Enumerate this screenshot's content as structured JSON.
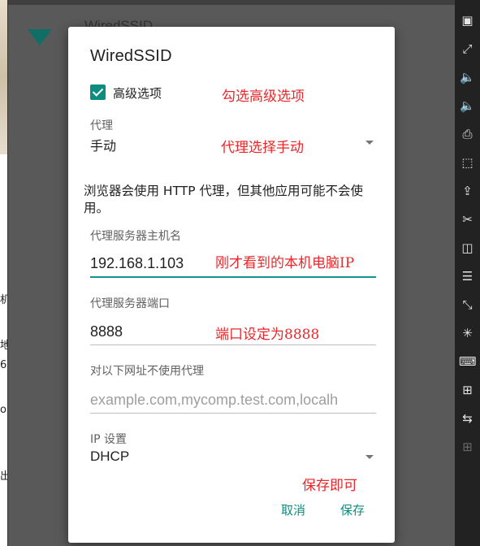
{
  "background": {
    "ssid": "WiredSSID",
    "left_strip": [
      "机",
      "地",
      "6",
      "o",
      "出"
    ]
  },
  "dialog": {
    "title": "WiredSSID",
    "advanced_checkbox": {
      "label": "高级选项",
      "checked": true
    },
    "proxy": {
      "label": "代理",
      "value": "手动"
    },
    "info_text": "浏览器会使用 HTTP 代理，但其他应用可能不会使用。",
    "proxy_host": {
      "label": "代理服务器主机名",
      "value": "192.168.1.103"
    },
    "proxy_port": {
      "label": "代理服务器端口",
      "value": "8888"
    },
    "bypass": {
      "label": "对以下网址不使用代理",
      "placeholder": "example.com,mycomp.test.com,localh"
    },
    "ip_settings": {
      "label": "IP 设置",
      "value": "DHCP"
    },
    "cancel_label": "取消",
    "save_label": "保存"
  },
  "annotations": {
    "advanced": "勾选高级选项",
    "proxy": "代理选择手动",
    "host": "刚才看到的本机电脑IP",
    "port": "端口设定为8888",
    "save": "保存即可"
  },
  "toolbar": {
    "icons": [
      "power-icon",
      "fullscreen-icon",
      "volume-up-icon",
      "volume-down-icon",
      "print-icon",
      "screenshot-icon",
      "install-apk-icon",
      "scissors-icon",
      "multi-window-icon",
      "menu-icon",
      "resize-icon",
      "loading-icon",
      "keyboard-icon",
      "virtual-location-icon",
      "swap-icon",
      "add-icon"
    ]
  },
  "colors": {
    "accent": "#0c8d80",
    "annotation": "#e8282b",
    "dialog_bg": "#ffffff",
    "overlay": "#595959",
    "toolbar_bg": "#222222"
  }
}
